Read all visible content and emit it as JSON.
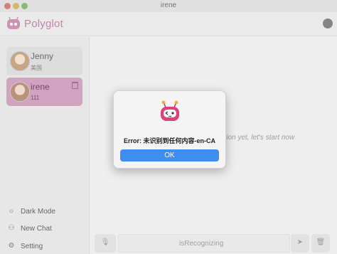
{
  "window": {
    "title": "irene"
  },
  "header": {
    "brand": "Polyglot",
    "github_icon": "github-icon"
  },
  "sidebar": {
    "chats": [
      {
        "name": "Jenny",
        "subtitle": "美国"
      },
      {
        "name": "irene",
        "subtitle": "111"
      }
    ],
    "menu": [
      {
        "icon": "☼",
        "label": "Dark Mode"
      },
      {
        "icon": "⚇",
        "label": "New Chat"
      },
      {
        "icon": "⚙",
        "label": "Setting"
      }
    ]
  },
  "main": {
    "empty_text": "ation yet, let's start now",
    "input_placeholder": "isRecognizing"
  },
  "dialog": {
    "message": "Error: 未识别到任何内容-en-CA",
    "ok_label": "OK"
  },
  "colors": {
    "brand": "#b46a94",
    "selected_chat": "#c98fb4",
    "ok_button": "#3d8ef0"
  }
}
